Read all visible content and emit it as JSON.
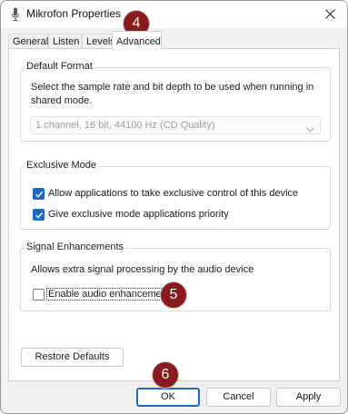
{
  "window": {
    "title": "Mikrofon Properties"
  },
  "tabs": [
    {
      "label": "General"
    },
    {
      "label": "Listen"
    },
    {
      "label": "Levels"
    },
    {
      "label": "Advanced"
    }
  ],
  "default_format": {
    "group_label": "Default Format",
    "description": "Select the sample rate and bit depth to be used when running in shared mode.",
    "selected_format": "1 channel, 16 bit, 44100 Hz (CD Quality)"
  },
  "exclusive_mode": {
    "group_label": "Exclusive Mode",
    "allow_exclusive_label": "Allow applications to take exclusive control of this device",
    "allow_exclusive_checked": true,
    "priority_label": "Give exclusive mode applications priority",
    "priority_checked": true
  },
  "signal_enhancements": {
    "group_label": "Signal Enhancements",
    "description": "Allows extra signal processing by the audio device",
    "enable_label": "Enable audio enhancements",
    "enable_checked": false
  },
  "buttons": {
    "restore_defaults": "Restore Defaults",
    "ok": "OK",
    "cancel": "Cancel",
    "apply": "Apply"
  },
  "annotations": [
    {
      "number": "4"
    },
    {
      "number": "5"
    },
    {
      "number": "6"
    }
  ],
  "colors": {
    "checkbox_accent": "#1d67c9",
    "badge_fill": "#8b1a1a"
  },
  "icons": {
    "title": "microphone-icon",
    "close": "close-icon",
    "dropdown": "chevron-down-icon",
    "check": "checkmark-icon"
  }
}
